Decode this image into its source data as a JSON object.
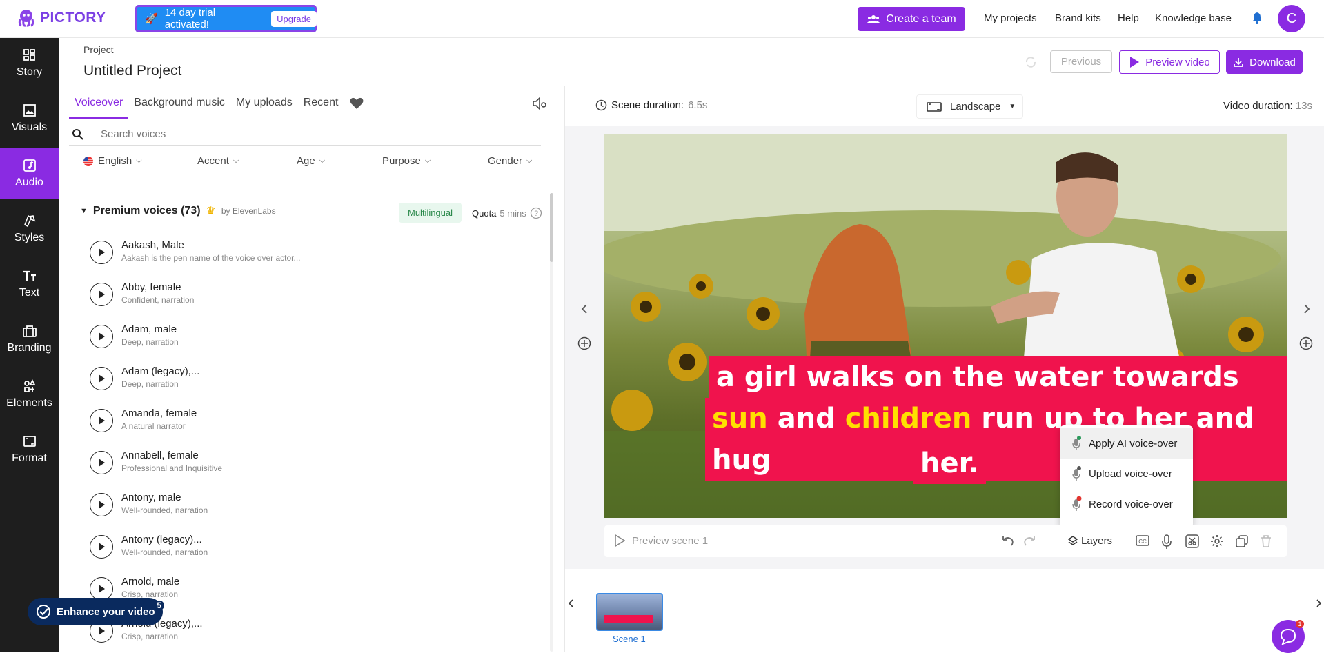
{
  "app": {
    "logo": "PICTORY",
    "trial_text": "14 day trial activated!",
    "upgrade_label": "Upgrade",
    "create_team": "Create a team",
    "nav": [
      "My projects",
      "Brand kits",
      "Help",
      "Knowledge base"
    ],
    "avatar_letter": "C",
    "brand_color": "#8a2be2"
  },
  "sidebar": {
    "items": [
      {
        "label": "Story",
        "icon": "grid-icon"
      },
      {
        "label": "Visuals",
        "icon": "image-icon"
      },
      {
        "label": "Audio",
        "icon": "music-icon",
        "active": true
      },
      {
        "label": "Styles",
        "icon": "styles-icon"
      },
      {
        "label": "Text",
        "icon": "text-icon"
      },
      {
        "label": "Branding",
        "icon": "briefcase-icon"
      },
      {
        "label": "Elements",
        "icon": "elements-icon"
      },
      {
        "label": "Format",
        "icon": "format-icon"
      }
    ]
  },
  "project": {
    "label": "Project",
    "title": "Untitled Project",
    "previous": "Previous",
    "preview_video": "Preview video",
    "download": "Download"
  },
  "audio_panel": {
    "tabs": [
      "Voiceover",
      "Background music",
      "My uploads",
      "Recent"
    ],
    "search_placeholder": "Search voices",
    "filters": [
      "English",
      "Accent",
      "Age",
      "Purpose",
      "Gender"
    ],
    "premium_title": "Premium voices (73)",
    "premium_by": "by ElevenLabs",
    "multilingual": "Multilingual",
    "quota_label": "Quota",
    "quota_value": "5 mins",
    "voices": [
      {
        "name": "Aakash, Male",
        "desc": "Aakash is the pen name of the voice over actor..."
      },
      {
        "name": "Abby, female",
        "desc": "Confident, narration"
      },
      {
        "name": "Adam, male",
        "desc": "Deep, narration"
      },
      {
        "name": "Adam (legacy),...",
        "desc": "Deep, narration"
      },
      {
        "name": "Amanda, female",
        "desc": "A natural narrator"
      },
      {
        "name": "Annabell, female",
        "desc": "Professional and Inquisitive"
      },
      {
        "name": "Antony, male",
        "desc": "Well-rounded, narration"
      },
      {
        "name": "Antony (legacy)...",
        "desc": "Well-rounded, narration"
      },
      {
        "name": "Arnold, male",
        "desc": "Crisp, narration"
      },
      {
        "name": "Arnold (legacy),...",
        "desc": "Crisp, narration"
      }
    ],
    "enhance_label": "Enhance your video",
    "enhance_badge": "5"
  },
  "scene": {
    "scene_duration_label": "Scene duration:",
    "scene_duration": "6.5s",
    "orientation": "Landscape",
    "video_duration_label": "Video duration:",
    "video_duration": "13s",
    "caption_line1": "a girl walks on the water towards the",
    "caption_line2_hl1": "sun",
    "caption_line2_mid": " and ",
    "caption_line2_hl2": "children",
    "caption_line2_rest": " run up to her and hug",
    "caption_line3": "her.",
    "voice_menu": [
      "Apply AI voice-over",
      "Upload voice-over",
      "Record voice-over"
    ],
    "preview_scene": "Preview scene 1",
    "layers": "Layers",
    "scene_thumb_label": "Scene 1",
    "chat_badge": "1"
  }
}
